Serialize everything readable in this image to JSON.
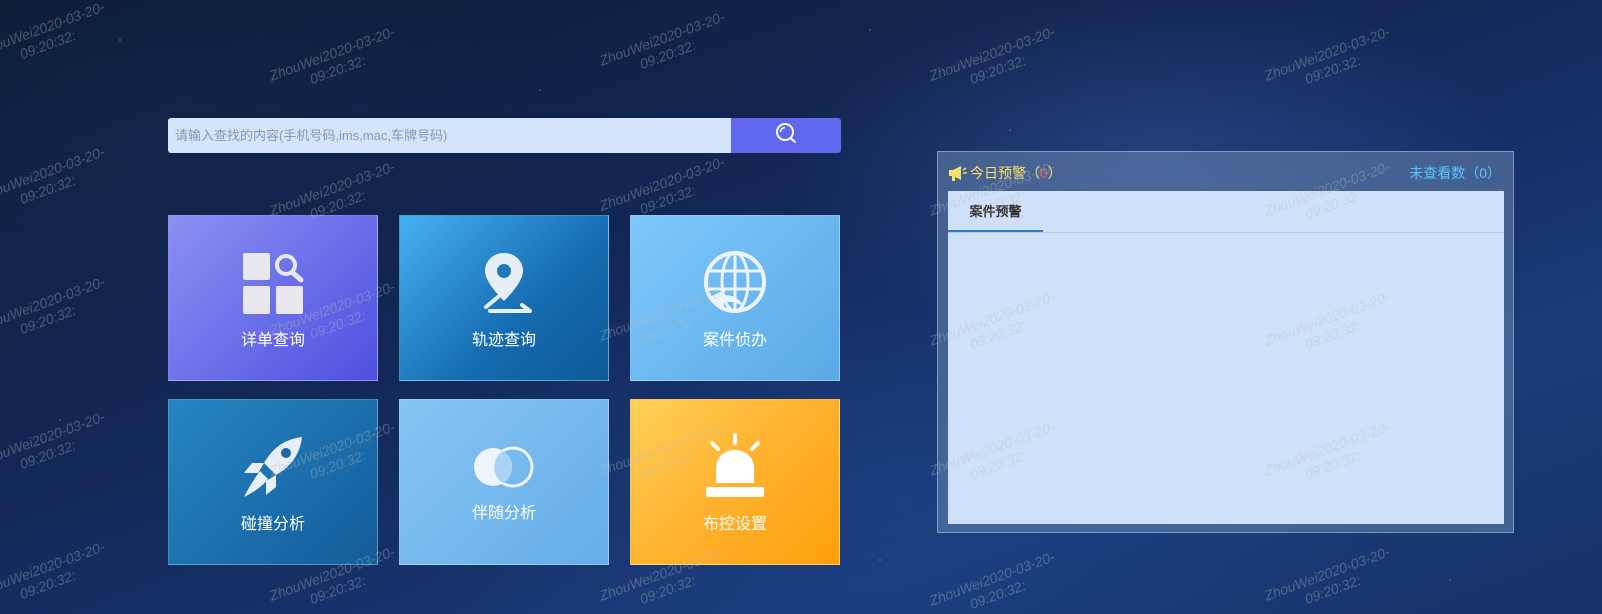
{
  "search": {
    "placeholder": "请输入查找的内容(手机号码,ims,mac,车牌号码)",
    "icon": "search-icon"
  },
  "tiles": [
    {
      "label": "详单查询",
      "icon": "grid-search-icon"
    },
    {
      "label": "轨迹查询",
      "icon": "location-route-icon"
    },
    {
      "label": "案件侦办",
      "icon": "globe-arrow-icon"
    },
    {
      "label": "碰撞分析",
      "icon": "rocket-icon"
    },
    {
      "label": "伴随分析",
      "icon": "overlap-circles-icon"
    },
    {
      "label": "布控设置",
      "icon": "alarm-siren-icon"
    }
  ],
  "alert_panel": {
    "title_prefix": "今日预警（",
    "today_count": "0",
    "title_suffix": "）",
    "unviewed_prefix": "未查看数（",
    "unviewed_count": "0",
    "unviewed_suffix": "）",
    "header_icon": "megaphone-icon",
    "tabs": [
      {
        "label": "案件预警",
        "active": true
      }
    ]
  },
  "watermark": {
    "line1": "ZhouWei2020-03-20-",
    "line2": "09:20:32:"
  },
  "colors": {
    "search_button": "#6068f0",
    "title_yellow": "#f8e06a",
    "count_red": "#ff5a4a",
    "unviewed_blue": "#58c6ff"
  }
}
